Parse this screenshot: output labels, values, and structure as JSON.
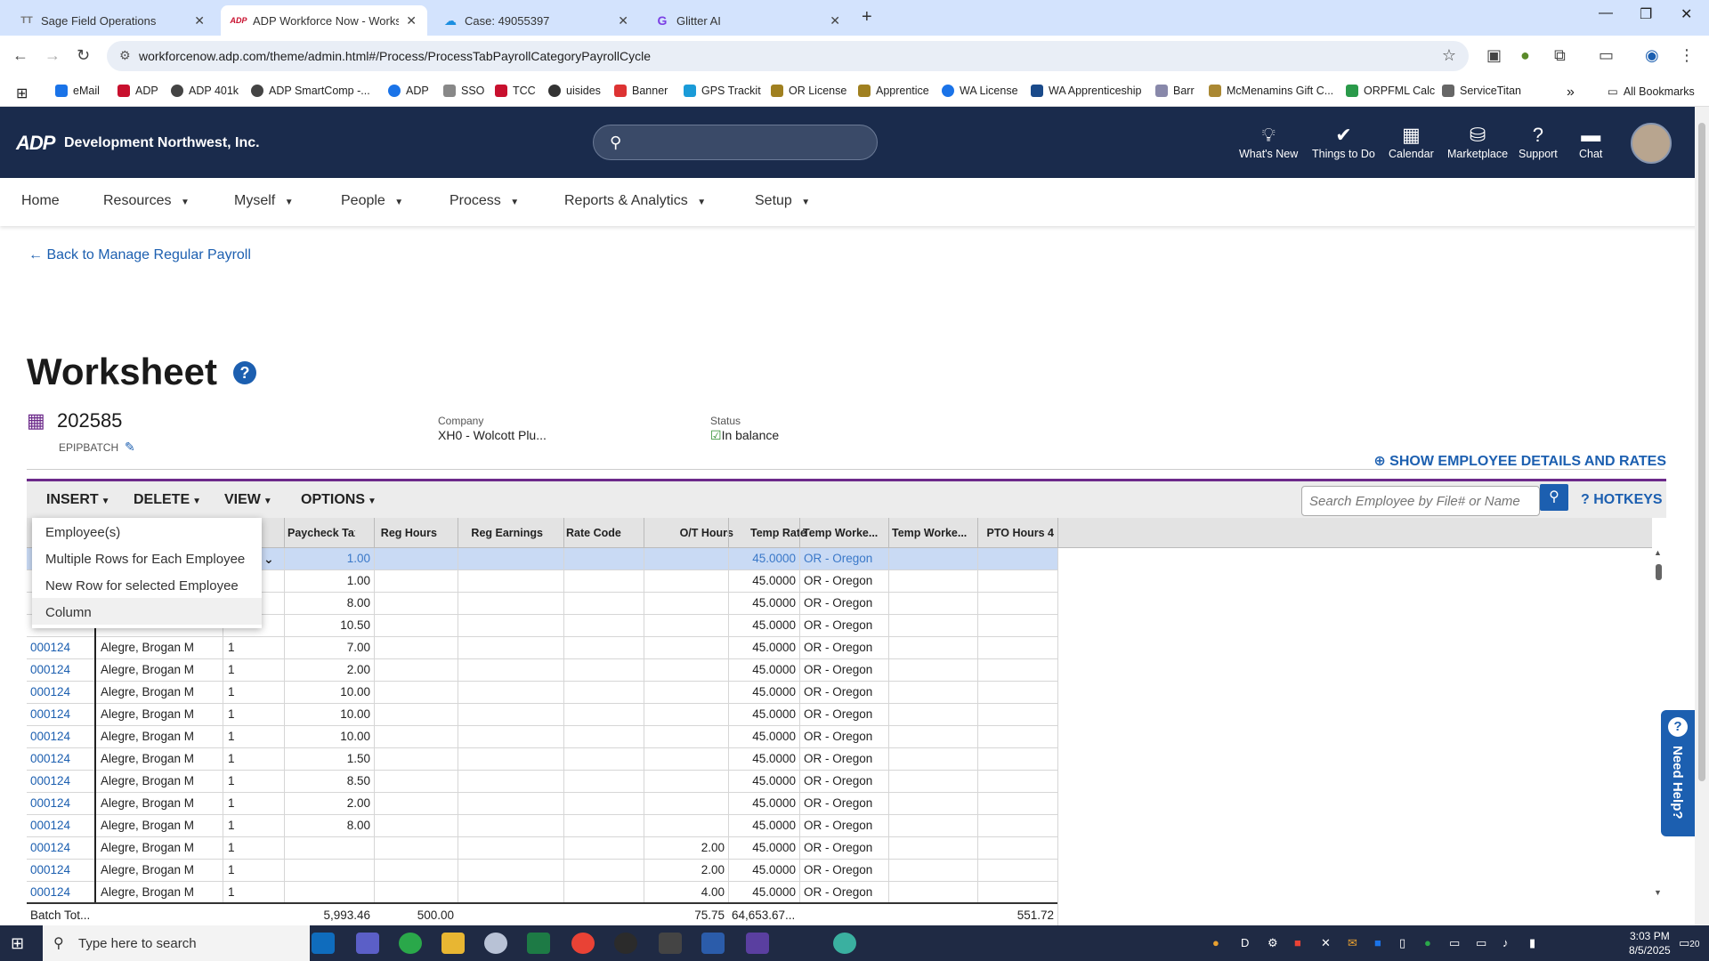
{
  "browser": {
    "tabs": [
      {
        "title": "Sage Field Operations",
        "icon": "TT"
      },
      {
        "title": "ADP Workforce Now - Workshe",
        "icon": "ADP"
      },
      {
        "title": "Case: 49055397",
        "icon": "chat-icon"
      },
      {
        "title": "Glitter AI",
        "icon": "G"
      }
    ],
    "url": "workforcenow.adp.com/theme/admin.html#/Process/ProcessTabPayrollCategoryPayrollCycle",
    "bookmarks": [
      "eMail",
      "ADP",
      "ADP 401k",
      "ADP SmartComp -...",
      "ADP",
      "SSO",
      "TCC",
      "uisides",
      "Banner",
      "GPS Trackit",
      "OR License",
      "Apprentice",
      "WA License",
      "WA Apprenticeship",
      "Barr",
      "McMenamins Gift C...",
      "ORPFML Calc",
      "ServiceTitan"
    ],
    "all_bookmarks": "All Bookmarks",
    "more": "»"
  },
  "header": {
    "logo": "ADP",
    "company": "Development Northwest, Inc.",
    "items": [
      {
        "label": "What's New",
        "icon": "lightbulb-icon"
      },
      {
        "label": "Things to Do",
        "icon": "checkmark-icon"
      },
      {
        "label": "Calendar",
        "icon": "calendar-icon"
      },
      {
        "label": "Marketplace",
        "icon": "bag-icon"
      },
      {
        "label": "Support",
        "icon": "question-icon"
      },
      {
        "label": "Chat",
        "icon": "chat-icon"
      }
    ]
  },
  "nav": {
    "items": [
      "Home",
      "Resources",
      "Myself",
      "People",
      "Process",
      "Reports & Analytics",
      "Setup"
    ]
  },
  "page": {
    "back_link": "Back to Manage Regular Payroll",
    "title": "Worksheet",
    "batch_number": "202585",
    "batch_name": "EPIPBATCH",
    "company_label": "Company",
    "company_value": "XH0 - Wolcott Plu...",
    "status_label": "Status",
    "status_value": "In balance",
    "show_details": "SHOW EMPLOYEE DETAILS AND RATES"
  },
  "ws_toolbar": {
    "menus": [
      "INSERT",
      "DELETE",
      "VIEW",
      "OPTIONS"
    ],
    "search_placeholder": "Search Employee by File# or Name",
    "hotkeys": "HOTKEYS"
  },
  "insert_menu": {
    "items": [
      "Employee(s)",
      "Multiple Rows for Each Employee",
      "New Row for selected Employee",
      "Column"
    ]
  },
  "grid": {
    "columns": [
      "Paycheck Tax...",
      "Reg Hours",
      "Reg Earnings",
      "Rate Code",
      "O/T Hours",
      "Temp Rate",
      "Temp Worke...",
      "Temp Worke...",
      "PTO Hours 4"
    ],
    "rows": [
      {
        "file": "",
        "name": "",
        "num": "",
        "reg_hours": "1.00",
        "ot_hours": "",
        "temp_rate": "45.0000",
        "state": "OR - Oregon"
      },
      {
        "file": "",
        "name": "",
        "num": "",
        "reg_hours": "1.00",
        "ot_hours": "",
        "temp_rate": "45.0000",
        "state": "OR - Oregon"
      },
      {
        "file": "",
        "name": "",
        "num": "",
        "reg_hours": "8.00",
        "ot_hours": "",
        "temp_rate": "45.0000",
        "state": "OR - Oregon"
      },
      {
        "file": "",
        "name": "",
        "num": "",
        "reg_hours": "10.50",
        "ot_hours": "",
        "temp_rate": "45.0000",
        "state": "OR - Oregon"
      },
      {
        "file": "000124",
        "name": "Alegre, Brogan M",
        "num": "1",
        "reg_hours": "7.00",
        "ot_hours": "",
        "temp_rate": "45.0000",
        "state": "OR - Oregon"
      },
      {
        "file": "000124",
        "name": "Alegre, Brogan M",
        "num": "1",
        "reg_hours": "2.00",
        "ot_hours": "",
        "temp_rate": "45.0000",
        "state": "OR - Oregon"
      },
      {
        "file": "000124",
        "name": "Alegre, Brogan M",
        "num": "1",
        "reg_hours": "10.00",
        "ot_hours": "",
        "temp_rate": "45.0000",
        "state": "OR - Oregon"
      },
      {
        "file": "000124",
        "name": "Alegre, Brogan M",
        "num": "1",
        "reg_hours": "10.00",
        "ot_hours": "",
        "temp_rate": "45.0000",
        "state": "OR - Oregon"
      },
      {
        "file": "000124",
        "name": "Alegre, Brogan M",
        "num": "1",
        "reg_hours": "10.00",
        "ot_hours": "",
        "temp_rate": "45.0000",
        "state": "OR - Oregon"
      },
      {
        "file": "000124",
        "name": "Alegre, Brogan M",
        "num": "1",
        "reg_hours": "1.50",
        "ot_hours": "",
        "temp_rate": "45.0000",
        "state": "OR - Oregon"
      },
      {
        "file": "000124",
        "name": "Alegre, Brogan M",
        "num": "1",
        "reg_hours": "8.50",
        "ot_hours": "",
        "temp_rate": "45.0000",
        "state": "OR - Oregon"
      },
      {
        "file": "000124",
        "name": "Alegre, Brogan M",
        "num": "1",
        "reg_hours": "2.00",
        "ot_hours": "",
        "temp_rate": "45.0000",
        "state": "OR - Oregon"
      },
      {
        "file": "000124",
        "name": "Alegre, Brogan M",
        "num": "1",
        "reg_hours": "8.00",
        "ot_hours": "",
        "temp_rate": "45.0000",
        "state": "OR - Oregon"
      },
      {
        "file": "000124",
        "name": "Alegre, Brogan M",
        "num": "1",
        "reg_hours": "",
        "ot_hours": "2.00",
        "temp_rate": "45.0000",
        "state": "OR - Oregon"
      },
      {
        "file": "000124",
        "name": "Alegre, Brogan M",
        "num": "1",
        "reg_hours": "",
        "ot_hours": "2.00",
        "temp_rate": "45.0000",
        "state": "OR - Oregon"
      },
      {
        "file": "000124",
        "name": "Alegre, Brogan M",
        "num": "1",
        "reg_hours": "",
        "ot_hours": "4.00",
        "temp_rate": "45.0000",
        "state": "OR - Oregon"
      }
    ],
    "totals": {
      "label": "Batch Tot...",
      "reg_hours": "5,993.46",
      "reg_earnings": "500.00",
      "ot_hours": "75.75",
      "temp_rate": "64,653.67...",
      "pto": "551.72"
    }
  },
  "need_help": "Need Help?",
  "taskbar": {
    "search_placeholder": "Type here to search",
    "time": "3:03 PM",
    "date": "8/5/2025",
    "notifications": "20"
  },
  "colors": {
    "adp_navy": "#1a2b4c",
    "accent_purple": "#6c2a8a",
    "link_blue": "#1c5fb0"
  }
}
